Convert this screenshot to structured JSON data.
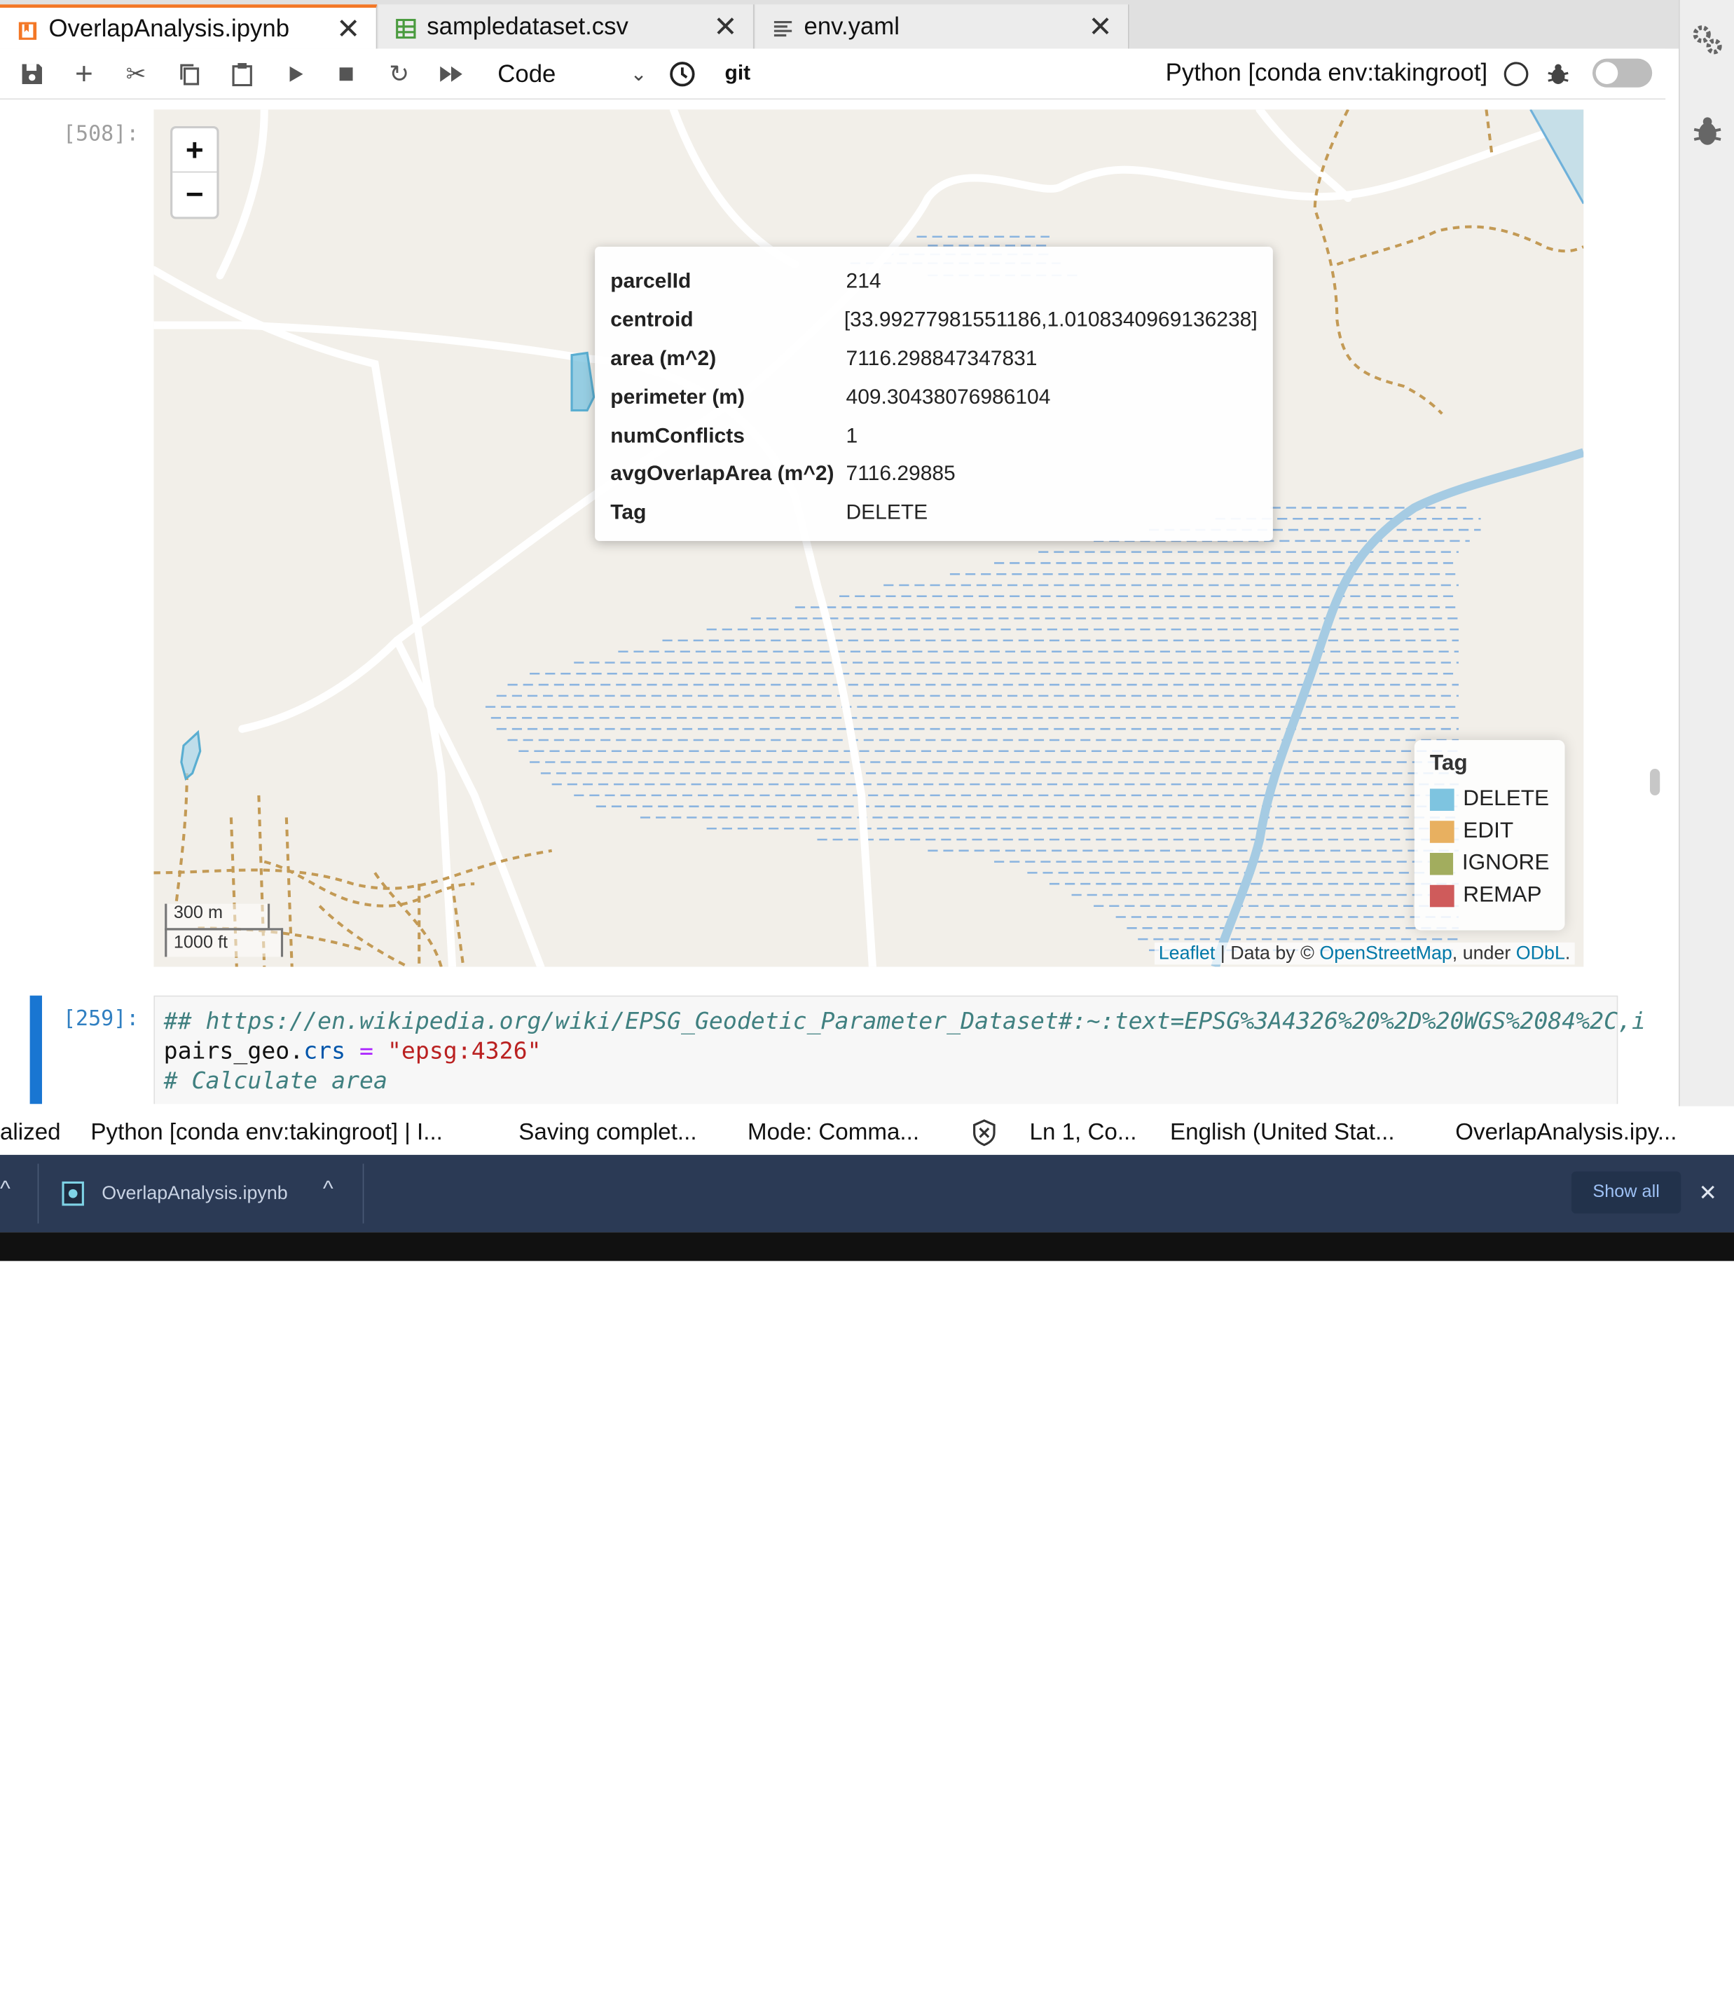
{
  "tabs": [
    {
      "label": "OverlapAnalysis.ipynb",
      "icon": "notebook-icon",
      "active": true
    },
    {
      "label": "sampledataset.csv",
      "icon": "spreadsheet-icon",
      "active": false
    },
    {
      "label": "env.yaml",
      "icon": "text-file-icon",
      "active": false
    }
  ],
  "toolbar": {
    "cell_type": "Code",
    "git_label": "git",
    "kernel_name": "Python [conda env:takingroot]"
  },
  "cells": {
    "map_cell": {
      "prompt": "[508]:",
      "map": {
        "zoom_in": "+",
        "zoom_out": "−",
        "popup": {
          "rows": [
            {
              "key": "parcelId",
              "value": "214"
            },
            {
              "key": "centroid",
              "value": "[33.99277981551186,1.0108340969136238]"
            },
            {
              "key": "area (m^2)",
              "value": "7116.298847347831"
            },
            {
              "key": "perimeter (m)",
              "value": "409.30438076986104"
            },
            {
              "key": "numConflicts",
              "value": "1"
            },
            {
              "key": "avgOverlapArea (m^2)",
              "value": "7116.29885"
            },
            {
              "key": "Tag",
              "value": "DELETE"
            }
          ]
        },
        "legend": {
          "title": "Tag",
          "items": [
            {
              "label": "DELETE",
              "color": "#7ec4e0"
            },
            {
              "label": "EDIT",
              "color": "#e8b060"
            },
            {
              "label": "IGNORE",
              "color": "#a2ad5e"
            },
            {
              "label": "REMAP",
              "color": "#cf5b5b"
            }
          ]
        },
        "scale": {
          "metric": "300 m",
          "imperial": "1000 ft"
        },
        "attribution": {
          "leaflet": "Leaflet",
          "sep1": " | Data by © ",
          "osm": "OpenStreetMap",
          "sep2": ", under ",
          "odbl": "ODbL",
          "end": "."
        }
      }
    },
    "code_cell": {
      "prompt": "[259]:",
      "line1": "## https://en.wikipedia.org/wiki/EPSG_Geodetic_Parameter_Dataset#:~:text=EPSG%3A4326%20%2D%20WGS%2084%2C,i",
      "line2_var": "pairs_geo",
      "line2_dot": ".",
      "line2_attr": "crs",
      "line2_eq": " = ",
      "line2_str": "\"epsg:4326\"",
      "line3": "# Calculate area"
    }
  },
  "status_bar": {
    "items": [
      "alized",
      "Python [conda env:takingroot] | I...",
      "Saving complet...",
      "Mode: Comma...",
      "Ln 1, Co...",
      "English (United Stat...",
      "OverlapAnalysis.ipy..."
    ]
  },
  "download_bar": {
    "filename": "OverlapAnalysis.ipynb",
    "show_all": "Show all"
  }
}
